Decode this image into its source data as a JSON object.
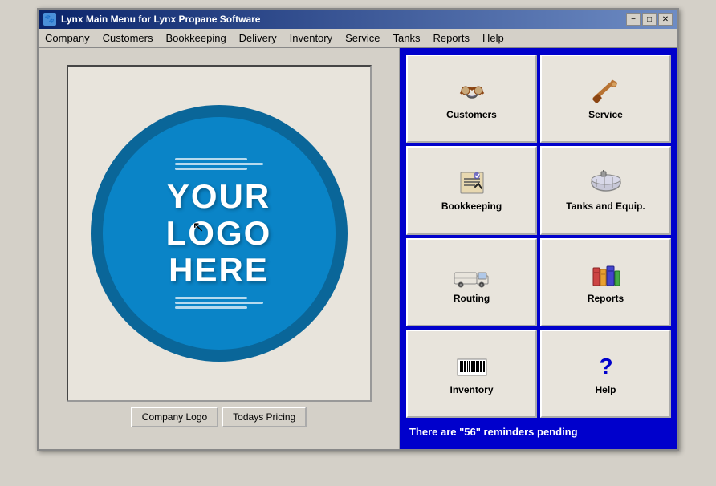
{
  "window": {
    "title": "Lynx Main Menu for Lynx Propane Software",
    "minimize_label": "−",
    "maximize_label": "□",
    "close_label": "✕"
  },
  "menubar": {
    "items": [
      {
        "label": "Company"
      },
      {
        "label": "Customers"
      },
      {
        "label": "Bookkeeping"
      },
      {
        "label": "Delivery"
      },
      {
        "label": "Inventory"
      },
      {
        "label": "Service"
      },
      {
        "label": "Tanks"
      },
      {
        "label": "Reports"
      },
      {
        "label": "Help"
      }
    ]
  },
  "logo": {
    "line1": "YOUR",
    "line2": "LOGO",
    "line3": "HERE"
  },
  "bottom_buttons": [
    {
      "label": "Company Logo"
    },
    {
      "label": "Todays Pricing"
    }
  ],
  "grid_buttons": [
    {
      "label": "Customers",
      "icon": "handshake"
    },
    {
      "label": "Service",
      "icon": "wrench"
    },
    {
      "label": "Bookkeeping",
      "icon": "pen"
    },
    {
      "label": "Tanks and Equip.",
      "icon": "tanks"
    },
    {
      "label": "Routing",
      "icon": "truck"
    },
    {
      "label": "Reports",
      "icon": "books"
    },
    {
      "label": "Inventory",
      "icon": "barcode"
    },
    {
      "label": "Help",
      "icon": "question"
    }
  ],
  "reminders": {
    "text": "There are \"56\" reminders pending"
  },
  "colors": {
    "right_panel_bg": "#0000cc",
    "logo_outer": "#0a6699",
    "logo_inner": "#0a84c7"
  }
}
